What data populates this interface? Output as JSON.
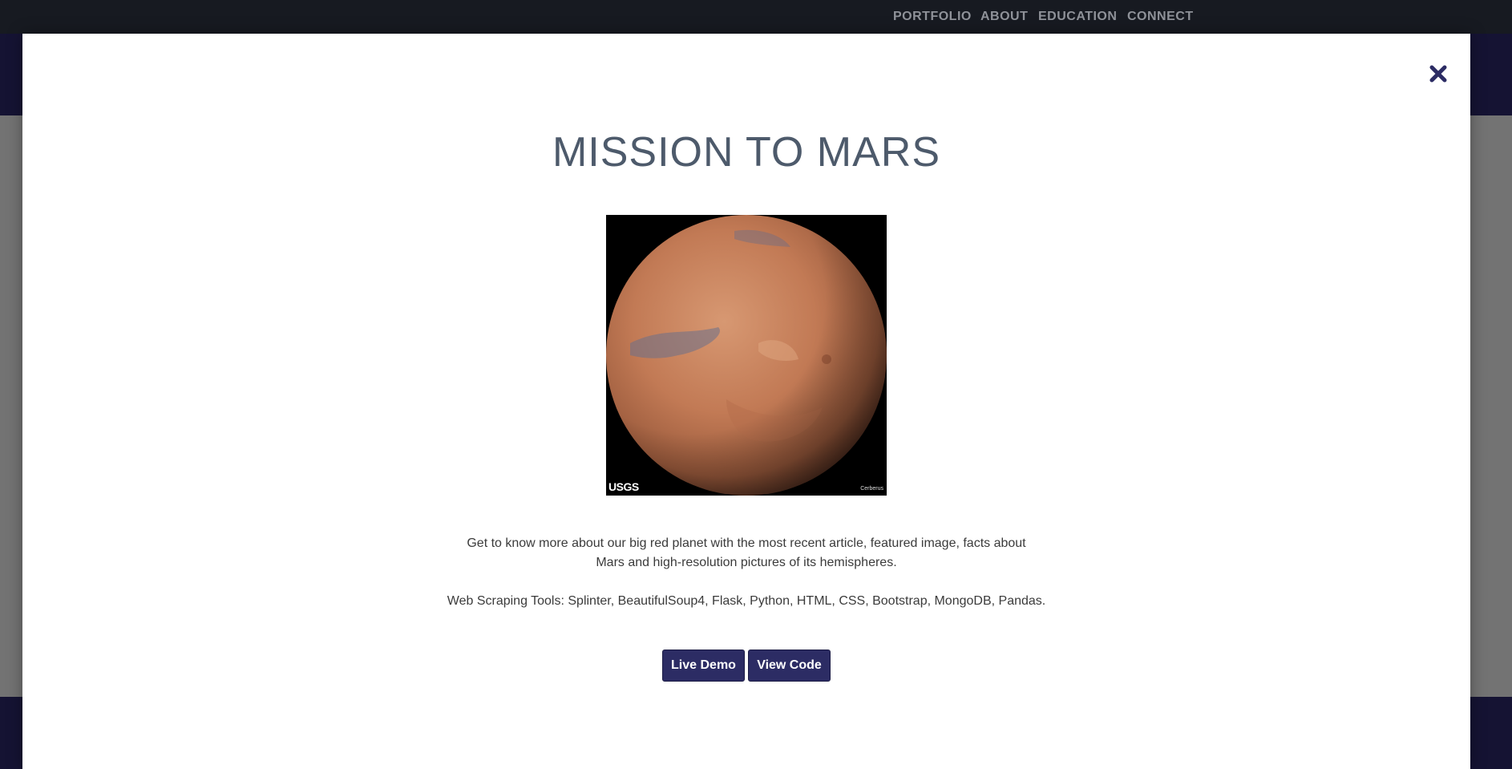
{
  "nav": {
    "items": [
      "PORTFOLIO",
      "ABOUT",
      "EDUCATION",
      "CONNECT"
    ]
  },
  "modal": {
    "title": "MISSION TO MARS",
    "image": {
      "logo_text": "USGS",
      "caption": "Cerberus"
    },
    "description": "Get to know more about our big red planet with the most recent article, featured image, facts about Mars and high-resolution pictures of its hemispheres.",
    "tools": "Web Scraping Tools: Splinter, BeautifulSoup4, Flask, Python, HTML, CSS, Bootstrap, MongoDB, Pandas.",
    "buttons": {
      "live_demo": "Live Demo",
      "view_code": "View Code"
    },
    "close_icon": "close-x-icon"
  },
  "colors": {
    "nav_bg": "#171a21",
    "band_bg": "#151333",
    "button_bg": "#2c2c64",
    "title_color": "#4d5a6b",
    "close_color": "#2c2c64"
  }
}
